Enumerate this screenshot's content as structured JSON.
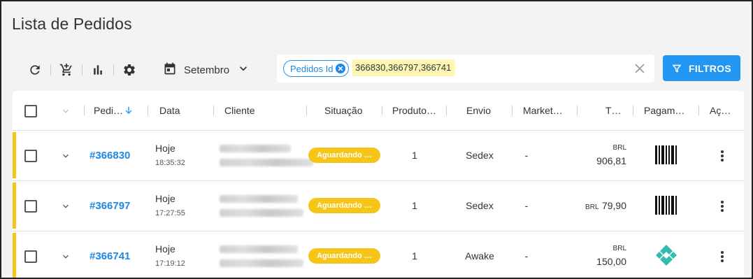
{
  "page": {
    "title": "Lista de Pedidos"
  },
  "toolbar": {
    "month_label": "Setembro",
    "icons": [
      "refresh-icon",
      "cart-add-icon",
      "bar-chart-icon",
      "gear-icon",
      "calendar-icon",
      "chevron-down-icon"
    ]
  },
  "filter": {
    "chip_label": "Pedidos Id",
    "chip_value": "366830,366797,366741",
    "button_label": "FILTROS"
  },
  "table": {
    "columns": [
      "Pedi…",
      "Data",
      "Cliente",
      "Situação",
      "Produto…",
      "Envio",
      "Market…",
      "T…",
      "Pagam…",
      "Aç…"
    ],
    "rows": [
      {
        "id": "#366830",
        "day": "Hoje",
        "time": "18:35:32",
        "status": "Aguardando …",
        "qty": "1",
        "envio": "Sedex",
        "market": "-",
        "currency": "BRL",
        "total": "906,81",
        "payment": "boleto-icon"
      },
      {
        "id": "#366797",
        "day": "Hoje",
        "time": "17:27:55",
        "status": "Aguardando …",
        "qty": "1",
        "envio": "Sedex",
        "market": "-",
        "currency": "BRL",
        "total": "79,90",
        "payment": "boleto-icon"
      },
      {
        "id": "#366741",
        "day": "Hoje",
        "time": "17:19:12",
        "status": "Aguardando …",
        "qty": "1",
        "envio": "Awake",
        "market": "-",
        "currency": "BRL",
        "total": "150,00",
        "payment": "pix-icon"
      }
    ]
  },
  "colors": {
    "accent": "#2196f3",
    "status_pending": "#f5c518",
    "chip_highlight": "#fdf7b3"
  }
}
